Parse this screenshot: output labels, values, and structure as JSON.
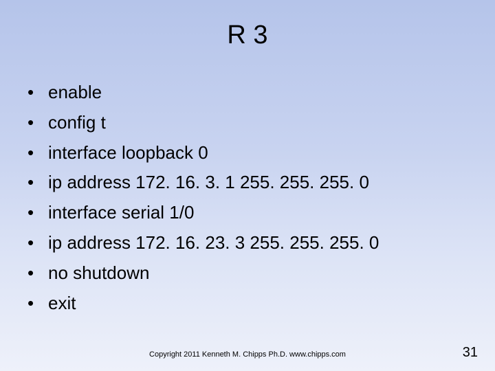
{
  "title": "R 3",
  "bullets": [
    "enable",
    "config t",
    "interface loopback 0",
    "ip address 172. 16. 3. 1 255. 255. 255. 0",
    "interface serial 1/0",
    "ip address 172. 16. 23. 3 255. 255. 255. 0",
    "no shutdown",
    "exit"
  ],
  "copyright": "Copyright 2011 Kenneth M. Chipps Ph.D. www.chipps.com",
  "pageNumber": "31"
}
